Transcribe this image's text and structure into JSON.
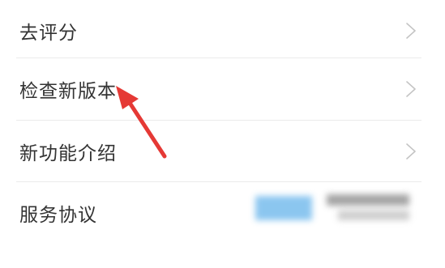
{
  "settings": {
    "items": [
      {
        "label": "去评分",
        "has_chevron": true
      },
      {
        "label": "检查新版本",
        "has_chevron": true
      },
      {
        "label": "新功能介绍",
        "has_chevron": true
      },
      {
        "label": "服务协议",
        "has_chevron": false
      }
    ]
  },
  "icons": {
    "chevron": "chevron-right-icon",
    "annotation": "red-arrow"
  },
  "colors": {
    "text": "#333333",
    "divider": "#ebebeb",
    "chevron": "#c4c4c4",
    "annotation_arrow": "#e53935",
    "blur_blue": "#7fc0ee",
    "blur_gray": "#9a9a9a"
  }
}
